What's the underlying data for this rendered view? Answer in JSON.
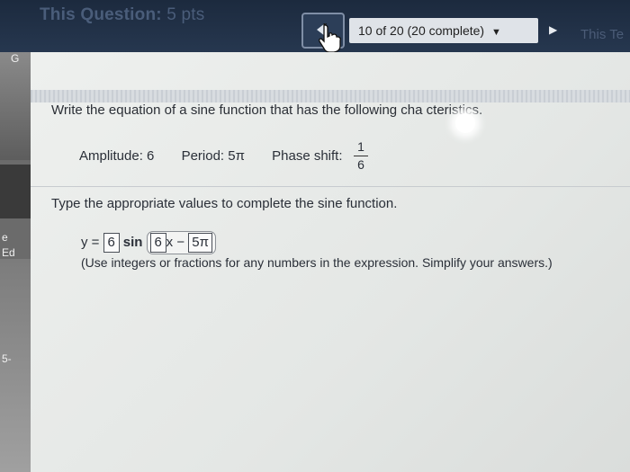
{
  "header": {
    "title_prefix": "This Question:",
    "title_points": "5 pts",
    "progress": "10 of 20 (20 complete)",
    "next_label": "This Te"
  },
  "question": {
    "prompt": "Write the equation of a sine function that has the following cha  cteristics.",
    "amplitude_label": "Amplitude: 6",
    "period_label": "Period: 5π",
    "phase_shift_label": "Phase shift:",
    "phase_num": "1",
    "phase_den": "6",
    "instruction": "Type the appropriate values to complete the sine function.",
    "equation": {
      "lhs": "y =",
      "amp_value": "6",
      "func": "sin",
      "b_value": "6",
      "x_var": "x",
      "minus": "−",
      "c_value": "5π"
    },
    "hint": "(Use integers or fractions for any numbers in the expression. Simplify your answers.)"
  },
  "left_strip": {
    "labels": [
      "G",
      "e",
      "Ed",
      "5-"
    ]
  }
}
